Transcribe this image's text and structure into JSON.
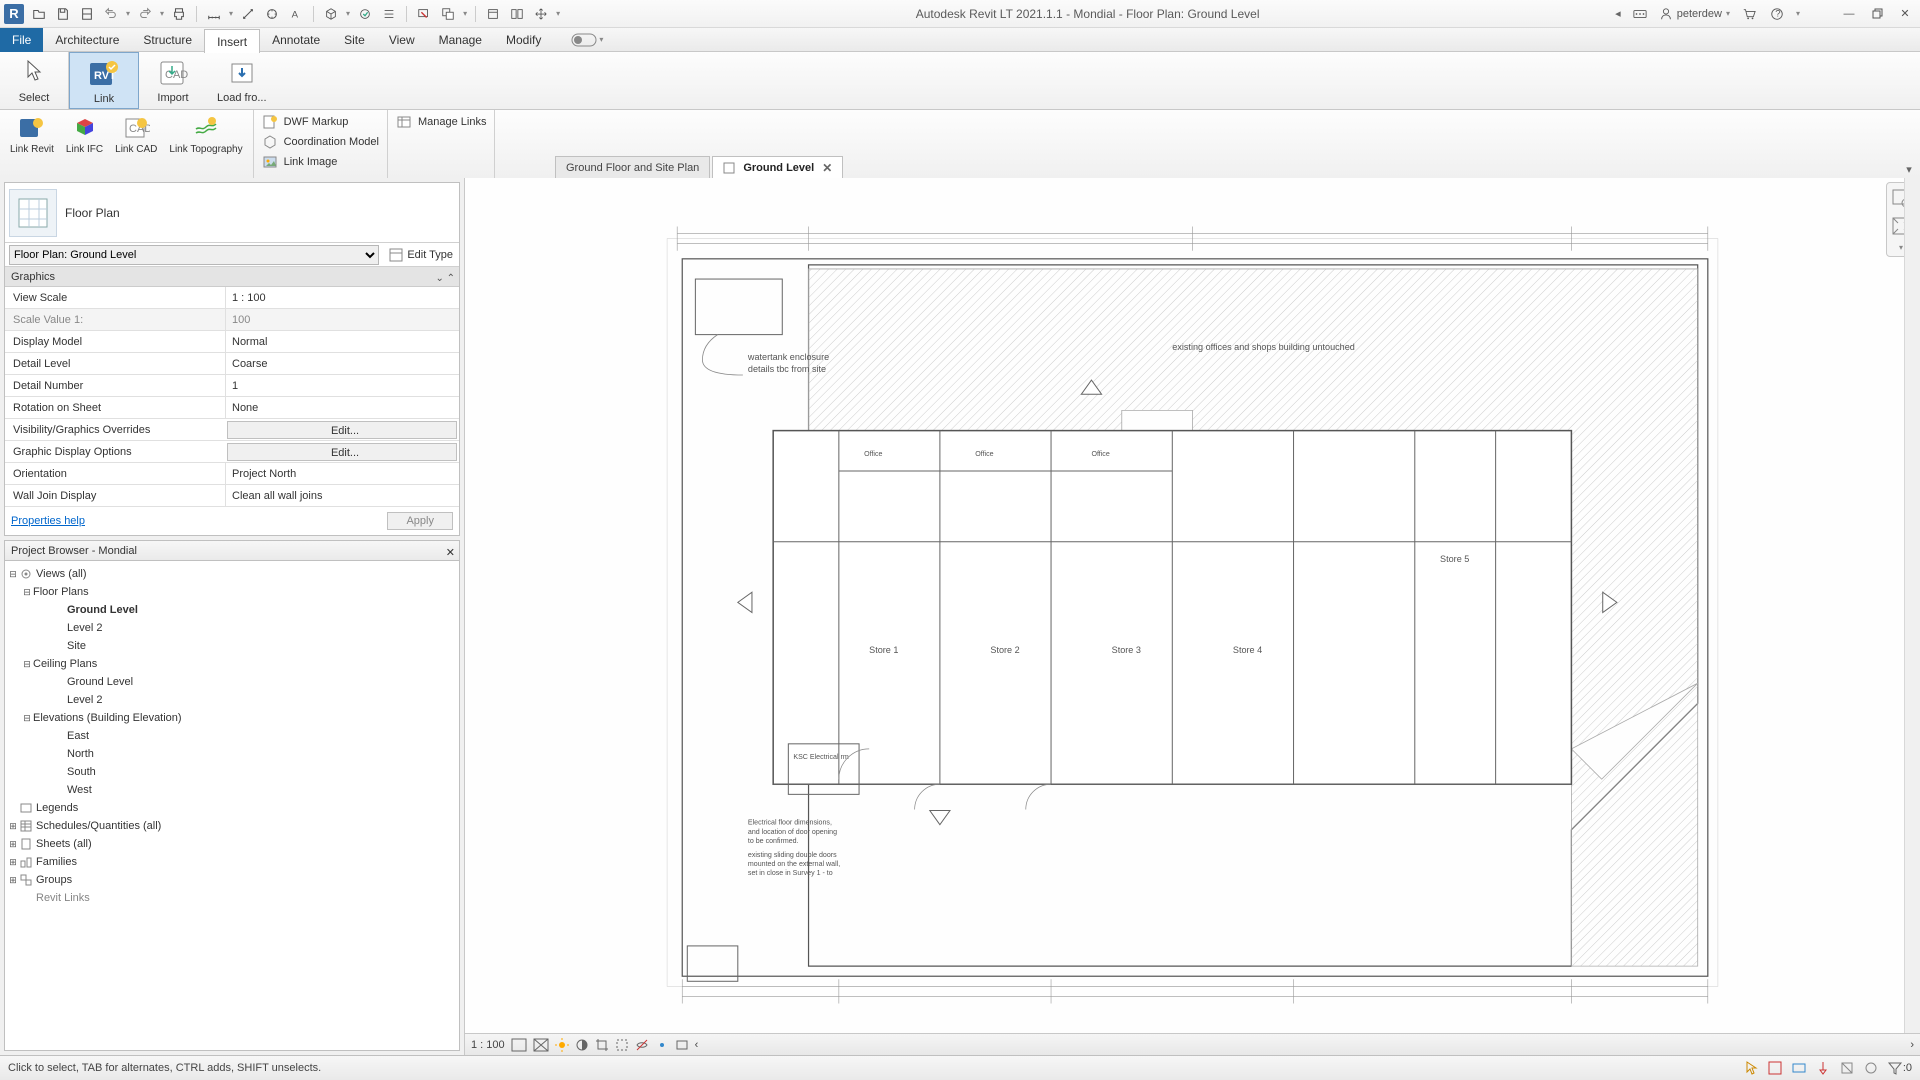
{
  "app": {
    "title": "Autodesk Revit LT 2021.1.1 - Mondial - Floor Plan: Ground Level",
    "user": "peterdew"
  },
  "menu": {
    "file": "File",
    "tabs": [
      "Architecture",
      "Structure",
      "Insert",
      "Annotate",
      "Site",
      "View",
      "Manage",
      "Modify"
    ],
    "active": "Insert"
  },
  "ribbon1": {
    "select": "Select",
    "link": "Link",
    "import": "Import",
    "load": "Load fro..."
  },
  "ribbon2": {
    "link_revit": "Link\nRevit",
    "link_ifc": "Link\nIFC",
    "link_cad": "Link\nCAD",
    "link_topo": "Link\nTopography",
    "dwf_markup": "DWF  Markup",
    "coord_model": "Coordination  Model",
    "link_image": "Link  Image",
    "manage_links": "Manage  Links"
  },
  "viewtabs": {
    "t1": "Ground Floor and Site Plan",
    "t2": "Ground Level"
  },
  "props": {
    "header_title": "Floor Plan",
    "selector": "Floor Plan: Ground Level",
    "edit_type": "Edit Type",
    "group_graphics": "Graphics",
    "rows": {
      "view_scale_k": "View Scale",
      "view_scale_v": "1 : 100",
      "scale_value_k": "Scale Value    1:",
      "scale_value_v": "100",
      "display_model_k": "Display Model",
      "display_model_v": "Normal",
      "detail_level_k": "Detail Level",
      "detail_level_v": "Coarse",
      "detail_number_k": "Detail Number",
      "detail_number_v": "1",
      "rotation_k": "Rotation on Sheet",
      "rotation_v": "None",
      "vg_k": "Visibility/Graphics Overrides",
      "vg_v": "Edit...",
      "gdo_k": "Graphic Display Options",
      "gdo_v": "Edit...",
      "orient_k": "Orientation",
      "orient_v": "Project North",
      "wjoin_k": "Wall Join Display",
      "wjoin_v": "Clean all wall joins"
    },
    "help": "Properties help",
    "apply": "Apply"
  },
  "browser": {
    "title": "Project Browser - Mondial",
    "views_all": "Views (all)",
    "floor_plans": "Floor Plans",
    "ground_level": "Ground Level",
    "level2": "Level 2",
    "site": "Site",
    "ceiling_plans": "Ceiling Plans",
    "cp_ground": "Ground Level",
    "cp_level2": "Level 2",
    "elevations": "Elevations (Building Elevation)",
    "east": "East",
    "north": "North",
    "south": "South",
    "west": "West",
    "legends": "Legends",
    "schedules": "Schedules/Quantities (all)",
    "sheets": "Sheets (all)",
    "families": "Families",
    "groups": "Groups",
    "revit_links": "Revit Links"
  },
  "plan": {
    "note1": "watertank enclosure",
    "note1b": "details tbc from site",
    "note2": "existing offices and shops building untouched",
    "office": "Office",
    "store1": "Store 1",
    "store2": "Store 2",
    "store3": "Store 3",
    "store4": "Store 4",
    "store5": "Store 5",
    "elec": "KSC Electrical rm",
    "note3a": "Electrical floor dimensions,",
    "note3b": "and location of door opening",
    "note3c": "to be confirmed.",
    "note4a": "existing sliding double doors",
    "note4b": "mounted on the external wall,",
    "note4c": "set in close in Survey 1 - to"
  },
  "viewbar": {
    "scale": "1 : 100"
  },
  "status": {
    "hint": "Click to select, TAB for alternates, CTRL adds, SHIFT unselects.",
    "filter": ":0"
  }
}
